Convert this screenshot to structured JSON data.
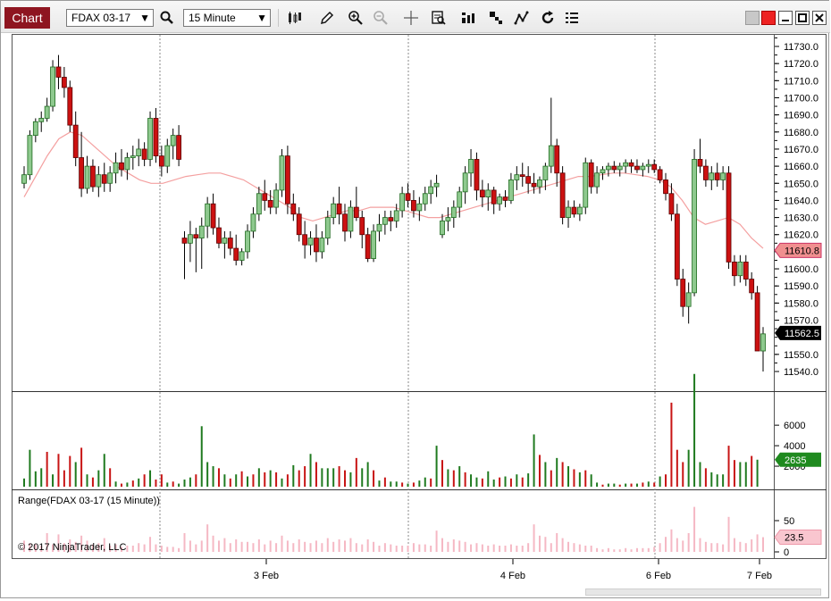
{
  "toolbar": {
    "chart_label": "Chart",
    "instrument": "FDAX 03-17",
    "interval": "15 Minute",
    "icons": [
      "search-icon",
      "bar-type-icon",
      "draw-pencil-icon",
      "zoom-in-icon",
      "zoom-out-icon",
      "crosshair-icon",
      "data-box-icon",
      "indicators-icon",
      "strategies-icon",
      "chart-trader-icon",
      "reload-icon",
      "properties-icon"
    ]
  },
  "window_controls": [
    "snapshot-icon",
    "link-icon",
    "minimize-icon",
    "maximize-icon",
    "close-icon"
  ],
  "colors": {
    "up": "#8ec98e",
    "up_border": "#1f6b1f",
    "down": "#cc1111",
    "down_border": "#5a0000",
    "wick": "#000000",
    "sma": "#f4a0a0",
    "vol_up": "#1f7a1f",
    "vol_down": "#c81414",
    "range": "#f5b8c4",
    "last_price_bg": "#000000",
    "sma_badge_bg": "#f08f8f",
    "vol_badge_bg": "#1f8a1f",
    "range_badge_bg": "#f9c6cf",
    "tab_bg": "#8e1520"
  },
  "price_axis": {
    "labels": [
      "11730.0",
      "11720.0",
      "11710.0",
      "11700.0",
      "11690.0",
      "11680.0",
      "11670.0",
      "11660.0",
      "11650.0",
      "11640.0",
      "11630.0",
      "11620.0",
      "11600.0",
      "11590.0",
      "11580.0",
      "11570.0",
      "11550.0",
      "11540.0"
    ],
    "sma_value": "11610.8",
    "last_price": "11562.5"
  },
  "volume_axis": {
    "labels": [
      "6000",
      "4000",
      "2000"
    ],
    "current": "2635"
  },
  "range_axis": {
    "labels": [
      "50",
      "0"
    ],
    "current": "23.5"
  },
  "indicator_label": "Range(FDAX 03-17 (15 Minute))",
  "copyright": "© 2017 NinjaTrader, LLC",
  "time_axis": [
    "3 Feb",
    "4 Feb",
    "6 Feb",
    "7 Feb"
  ],
  "chart_data": {
    "type": "candlestick",
    "instrument": "FDAX 03-17",
    "interval": "15 Minute",
    "ohlc": [
      [
        11650,
        11660,
        11647,
        11655
      ],
      [
        11655,
        11681,
        11652,
        11678
      ],
      [
        11678,
        11688,
        11674,
        11686
      ],
      [
        11686,
        11692,
        11680,
        11688
      ],
      [
        11688,
        11700,
        11686,
        11695
      ],
      [
        11695,
        11722,
        11692,
        11718
      ],
      [
        11718,
        11725,
        11705,
        11712
      ],
      [
        11712,
        11718,
        11700,
        11706
      ],
      [
        11706,
        11710,
        11680,
        11684
      ],
      [
        11684,
        11692,
        11660,
        11665
      ],
      [
        11665,
        11680,
        11642,
        11647
      ],
      [
        11647,
        11666,
        11644,
        11660
      ],
      [
        11660,
        11664,
        11645,
        11648
      ],
      [
        11648,
        11660,
        11642,
        11655
      ],
      [
        11655,
        11662,
        11645,
        11650
      ],
      [
        11650,
        11660,
        11645,
        11656
      ],
      [
        11656,
        11668,
        11650,
        11662
      ],
      [
        11662,
        11670,
        11654,
        11658
      ],
      [
        11658,
        11668,
        11652,
        11665
      ],
      [
        11665,
        11672,
        11658,
        11666
      ],
      [
        11666,
        11676,
        11660,
        11670
      ],
      [
        11670,
        11674,
        11660,
        11664
      ],
      [
        11664,
        11692,
        11660,
        11688
      ],
      [
        11688,
        11694,
        11662,
        11666
      ],
      [
        11666,
        11672,
        11654,
        11660
      ],
      [
        11660,
        11676,
        11656,
        11672
      ],
      [
        11672,
        11682,
        11664,
        11678
      ],
      [
        11678,
        11684,
        11660,
        11664
      ],
      [
        11618,
        11622,
        11594,
        11615
      ],
      [
        11615,
        11628,
        11604,
        11620
      ],
      [
        11620,
        11624,
        11598,
        11618
      ],
      [
        11618,
        11630,
        11600,
        11625
      ],
      [
        11625,
        11642,
        11618,
        11638
      ],
      [
        11638,
        11644,
        11620,
        11624
      ],
      [
        11624,
        11630,
        11612,
        11615
      ],
      [
        11615,
        11622,
        11606,
        11618
      ],
      [
        11618,
        11622,
        11608,
        11612
      ],
      [
        11612,
        11620,
        11602,
        11605
      ],
      [
        11605,
        11612,
        11602,
        11610
      ],
      [
        11610,
        11626,
        11606,
        11622
      ],
      [
        11622,
        11636,
        11618,
        11632
      ],
      [
        11632,
        11648,
        11628,
        11644
      ],
      [
        11644,
        11652,
        11634,
        11640
      ],
      [
        11640,
        11646,
        11632,
        11636
      ],
      [
        11636,
        11650,
        11632,
        11646
      ],
      [
        11646,
        11670,
        11642,
        11666
      ],
      [
        11666,
        11672,
        11632,
        11638
      ],
      [
        11638,
        11644,
        11628,
        11632
      ],
      [
        11632,
        11636,
        11616,
        11620
      ],
      [
        11620,
        11628,
        11606,
        11614
      ],
      [
        11614,
        11622,
        11608,
        11618
      ],
      [
        11618,
        11626,
        11604,
        11610
      ],
      [
        11610,
        11622,
        11606,
        11618
      ],
      [
        11618,
        11634,
        11614,
        11630
      ],
      [
        11630,
        11642,
        11626,
        11638
      ],
      [
        11638,
        11648,
        11626,
        11632
      ],
      [
        11632,
        11638,
        11616,
        11622
      ],
      [
        11622,
        11640,
        11618,
        11636
      ],
      [
        11636,
        11648,
        11628,
        11630
      ],
      [
        11630,
        11634,
        11612,
        11620
      ],
      [
        11620,
        11624,
        11604,
        11606
      ],
      [
        11606,
        11626,
        11604,
        11622
      ],
      [
        11622,
        11632,
        11616,
        11626
      ],
      [
        11626,
        11634,
        11620,
        11630
      ],
      [
        11630,
        11634,
        11622,
        11628
      ],
      [
        11628,
        11638,
        11624,
        11634
      ],
      [
        11634,
        11648,
        11630,
        11644
      ],
      [
        11644,
        11650,
        11636,
        11640
      ],
      [
        11640,
        11646,
        11630,
        11634
      ],
      [
        11634,
        11642,
        11628,
        11638
      ],
      [
        11638,
        11648,
        11634,
        11644
      ],
      [
        11644,
        11652,
        11638,
        11648
      ],
      [
        11648,
        11655,
        11642,
        11650
      ],
      [
        11620,
        11632,
        11618,
        11628
      ],
      [
        11628,
        11636,
        11622,
        11630
      ],
      [
        11630,
        11640,
        11624,
        11636
      ],
      [
        11636,
        11648,
        11630,
        11645
      ],
      [
        11645,
        11660,
        11638,
        11656
      ],
      [
        11656,
        11670,
        11648,
        11664
      ],
      [
        11664,
        11668,
        11640,
        11646
      ],
      [
        11646,
        11652,
        11636,
        11642
      ],
      [
        11642,
        11650,
        11634,
        11646
      ],
      [
        11646,
        11648,
        11632,
        11638
      ],
      [
        11638,
        11644,
        11634,
        11642
      ],
      [
        11642,
        11646,
        11636,
        11640
      ],
      [
        11640,
        11656,
        11638,
        11652
      ],
      [
        11652,
        11660,
        11646,
        11655
      ],
      [
        11655,
        11662,
        11648,
        11654
      ],
      [
        11654,
        11660,
        11644,
        11650
      ],
      [
        11650,
        11656,
        11644,
        11648
      ],
      [
        11648,
        11654,
        11644,
        11652
      ],
      [
        11652,
        11662,
        11646,
        11660
      ],
      [
        11660,
        11700,
        11656,
        11672
      ],
      [
        11672,
        11676,
        11648,
        11656
      ],
      [
        11656,
        11660,
        11626,
        11630
      ],
      [
        11630,
        11640,
        11624,
        11636
      ],
      [
        11636,
        11640,
        11630,
        11632
      ],
      [
        11632,
        11638,
        11628,
        11636
      ],
      [
        11636,
        11665,
        11632,
        11662
      ],
      [
        11662,
        11664,
        11644,
        11648
      ],
      [
        11648,
        11660,
        11644,
        11656
      ],
      [
        11656,
        11660,
        11652,
        11658
      ],
      [
        11658,
        11662,
        11654,
        11660
      ],
      [
        11660,
        11663,
        11656,
        11658
      ],
      [
        11658,
        11662,
        11654,
        11660
      ],
      [
        11660,
        11664,
        11656,
        11662
      ],
      [
        11662,
        11664,
        11656,
        11660
      ],
      [
        11660,
        11664,
        11656,
        11658
      ],
      [
        11658,
        11662,
        11654,
        11660
      ],
      [
        11660,
        11664,
        11656,
        11661
      ],
      [
        11661,
        11664,
        11656,
        11658
      ],
      [
        11658,
        11660,
        11650,
        11652
      ],
      [
        11652,
        11656,
        11640,
        11644
      ],
      [
        11644,
        11650,
        11628,
        11632
      ],
      [
        11632,
        11638,
        11590,
        11594
      ],
      [
        11594,
        11600,
        11572,
        11578
      ],
      [
        11578,
        11592,
        11568,
        11586
      ],
      [
        11586,
        11670,
        11584,
        11664
      ],
      [
        11664,
        11676,
        11656,
        11660
      ],
      [
        11660,
        11664,
        11648,
        11652
      ],
      [
        11652,
        11660,
        11646,
        11656
      ],
      [
        11656,
        11662,
        11648,
        11652
      ],
      [
        11652,
        11660,
        11646,
        11656
      ],
      [
        11656,
        11660,
        11600,
        11604
      ],
      [
        11604,
        11608,
        11590,
        11596
      ],
      [
        11596,
        11608,
        11592,
        11604
      ],
      [
        11604,
        11608,
        11590,
        11594
      ],
      [
        11594,
        11598,
        11582,
        11586
      ],
      [
        11586,
        11590,
        11560,
        11552
      ],
      [
        11552,
        11566,
        11540,
        11562
      ]
    ],
    "sma": [
      11642,
      11654,
      11666,
      11676,
      11680,
      11678,
      11672,
      11666,
      11660,
      11656,
      11652,
      11650,
      11650,
      11652,
      11654,
      11655,
      11656,
      11656,
      11654,
      11652,
      11648,
      11644,
      11640,
      11636,
      11630,
      11628,
      11630,
      11632,
      11634,
      11634,
      11636,
      11636,
      11636,
      11634,
      11632,
      11630,
      11630,
      11632,
      11634,
      11636,
      11638,
      11640,
      11642,
      11644,
      11646,
      11648,
      11650,
      11652,
      11654,
      11654,
      11655,
      11656,
      11656,
      11655,
      11654,
      11652,
      11648,
      11640,
      11630,
      11626,
      11628,
      11630,
      11626,
      11618,
      11612
    ],
    "volume": [
      [
        800,
        1
      ],
      [
        3600,
        1
      ],
      [
        1500,
        1
      ],
      [
        1800,
        1
      ],
      [
        3400,
        0
      ],
      [
        1200,
        1
      ],
      [
        3200,
        0
      ],
      [
        1600,
        0
      ],
      [
        3000,
        0
      ],
      [
        2400,
        1
      ],
      [
        3800,
        0
      ],
      [
        1200,
        1
      ],
      [
        900,
        0
      ],
      [
        1600,
        1
      ],
      [
        3200,
        1
      ],
      [
        1800,
        0
      ],
      [
        500,
        1
      ],
      [
        300,
        0
      ],
      [
        400,
        1
      ],
      [
        600,
        0
      ],
      [
        800,
        1
      ],
      [
        1200,
        0
      ],
      [
        1600,
        1
      ],
      [
        700,
        0
      ],
      [
        1200,
        0
      ],
      [
        400,
        1
      ],
      [
        500,
        0
      ],
      [
        300,
        1
      ],
      [
        700,
        1
      ],
      [
        900,
        1
      ],
      [
        1200,
        0
      ],
      [
        5900,
        1
      ],
      [
        2400,
        1
      ],
      [
        2000,
        1
      ],
      [
        1800,
        0
      ],
      [
        1200,
        1
      ],
      [
        800,
        0
      ],
      [
        1200,
        1
      ],
      [
        1500,
        0
      ],
      [
        1000,
        1
      ],
      [
        1200,
        0
      ],
      [
        1800,
        1
      ],
      [
        1400,
        0
      ],
      [
        1600,
        1
      ],
      [
        1400,
        0
      ],
      [
        800,
        1
      ],
      [
        1200,
        0
      ],
      [
        2100,
        1
      ],
      [
        1600,
        0
      ],
      [
        2000,
        0
      ],
      [
        3200,
        1
      ],
      [
        2400,
        0
      ],
      [
        1800,
        1
      ],
      [
        1800,
        1
      ],
      [
        1800,
        1
      ],
      [
        2000,
        0
      ],
      [
        1600,
        0
      ],
      [
        1400,
        1
      ],
      [
        2800,
        0
      ],
      [
        1800,
        1
      ],
      [
        2400,
        1
      ],
      [
        1600,
        0
      ],
      [
        600,
        1
      ],
      [
        900,
        0
      ],
      [
        500,
        1
      ],
      [
        500,
        1
      ],
      [
        400,
        0
      ],
      [
        300,
        1
      ],
      [
        400,
        0
      ],
      [
        600,
        1
      ],
      [
        900,
        1
      ],
      [
        800,
        0
      ],
      [
        4000,
        1
      ],
      [
        2600,
        0
      ],
      [
        1700,
        1
      ],
      [
        1600,
        0
      ],
      [
        2000,
        1
      ],
      [
        1400,
        0
      ],
      [
        1200,
        1
      ],
      [
        900,
        1
      ],
      [
        800,
        0
      ],
      [
        1500,
        1
      ],
      [
        700,
        1
      ],
      [
        900,
        0
      ],
      [
        1000,
        1
      ],
      [
        800,
        0
      ],
      [
        1200,
        1
      ],
      [
        900,
        0
      ],
      [
        1300,
        1
      ],
      [
        5100,
        1
      ],
      [
        3100,
        0
      ],
      [
        2400,
        1
      ],
      [
        1600,
        0
      ],
      [
        2800,
        1
      ],
      [
        2400,
        0
      ],
      [
        2000,
        1
      ],
      [
        1700,
        0
      ],
      [
        1400,
        1
      ],
      [
        1600,
        0
      ],
      [
        1200,
        1
      ],
      [
        400,
        1
      ],
      [
        200,
        0
      ],
      [
        300,
        1
      ],
      [
        300,
        1
      ],
      [
        200,
        0
      ],
      [
        300,
        1
      ],
      [
        300,
        0
      ],
      [
        300,
        1
      ],
      [
        400,
        0
      ],
      [
        500,
        1
      ],
      [
        400,
        0
      ],
      [
        1000,
        1
      ],
      [
        1200,
        0
      ],
      [
        8200,
        0
      ],
      [
        3600,
        0
      ],
      [
        2400,
        0
      ],
      [
        3600,
        1
      ],
      [
        11000,
        1
      ],
      [
        2400,
        1
      ],
      [
        1800,
        0
      ],
      [
        1400,
        1
      ],
      [
        1200,
        1
      ],
      [
        1200,
        1
      ],
      [
        4000,
        0
      ],
      [
        2600,
        0
      ],
      [
        2400,
        1
      ],
      [
        2400,
        1
      ],
      [
        3000,
        0
      ],
      [
        2635,
        1
      ]
    ],
    "range": [
      18,
      14,
      12,
      10,
      30,
      12,
      28,
      14,
      20,
      16,
      26,
      18,
      12,
      14,
      22,
      10,
      12,
      8,
      10,
      10,
      14,
      12,
      24,
      12,
      10,
      8,
      8,
      6,
      30,
      18,
      12,
      18,
      44,
      26,
      18,
      22,
      14,
      20,
      16,
      16,
      14,
      20,
      12,
      18,
      14,
      26,
      18,
      14,
      20,
      16,
      14,
      18,
      14,
      22,
      16,
      20,
      18,
      22,
      14,
      12,
      20,
      16,
      10,
      14,
      12,
      10,
      10,
      10,
      14,
      12,
      12,
      10,
      34,
      22,
      16,
      20,
      18,
      16,
      12,
      14,
      12,
      10,
      12,
      10,
      10,
      12,
      10,
      10,
      14,
      44,
      26,
      24,
      14,
      30,
      22,
      16,
      14,
      12,
      10,
      10,
      6,
      4,
      6,
      4,
      4,
      6,
      4,
      6,
      6,
      6,
      8,
      14,
      24,
      36,
      22,
      18,
      30,
      72,
      22,
      16,
      14,
      14,
      12,
      56,
      22,
      16,
      14,
      20,
      28,
      23.5
    ]
  }
}
